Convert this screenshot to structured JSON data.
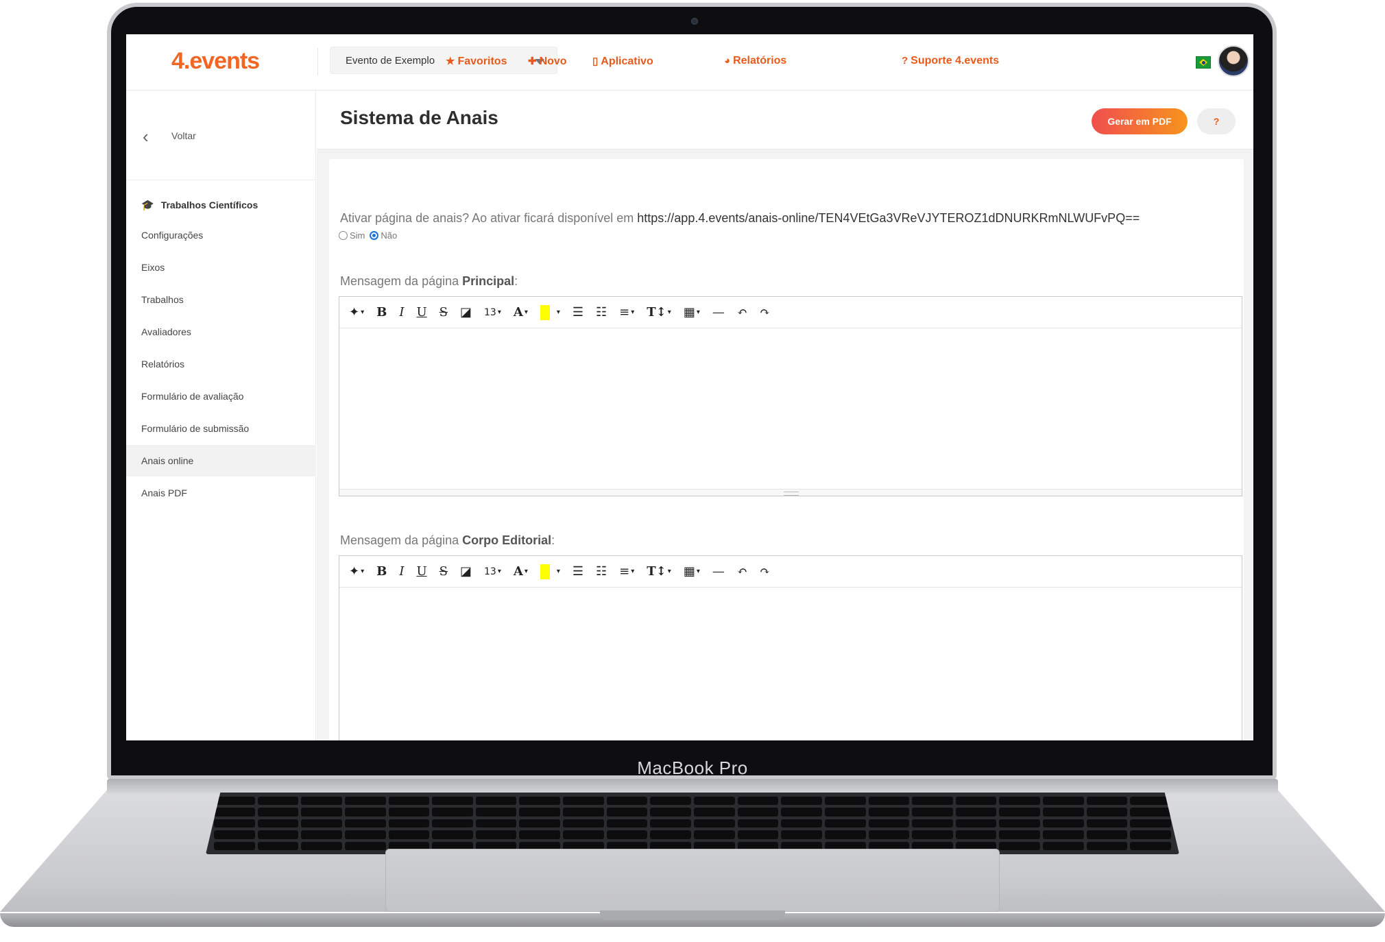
{
  "device": {
    "label": "MacBook Pro"
  },
  "topbar": {
    "logo": "4.events",
    "event_select": "Evento de Exemplo",
    "nav": [
      {
        "icon": "star-icon",
        "glyph": "★",
        "label": "Favoritos"
      },
      {
        "icon": "plus-icon",
        "glyph": "✚",
        "label": "Novo"
      },
      {
        "icon": "mobile-icon",
        "glyph": "▯",
        "label": "Aplicativo"
      },
      {
        "icon": "pie-chart-icon",
        "glyph": "◕",
        "label": "Relatórios"
      },
      {
        "icon": "question-circle-icon",
        "glyph": "?",
        "label": "Suporte 4.events"
      }
    ],
    "language_flag": "brazil-flag-icon"
  },
  "sidebar": {
    "back_label": "Voltar",
    "section_title": "Trabalhos Científicos",
    "section_icon": "graduation-cap-icon",
    "items": [
      {
        "label": "Configurações"
      },
      {
        "label": "Eixos"
      },
      {
        "label": "Trabalhos"
      },
      {
        "label": "Avaliadores"
      },
      {
        "label": "Relatórios"
      },
      {
        "label": "Formulário de avaliação"
      },
      {
        "label": "Formulário de submissão"
      },
      {
        "label": "Anais online",
        "active": true
      },
      {
        "label": "Anais PDF"
      }
    ]
  },
  "page": {
    "title": "Sistema de Anais",
    "pdf_button": "Gerar em PDF",
    "help_button": "?",
    "question": "Ativar página de anais? Ao ativar ficará disponível em",
    "question_url": "https://app.4.events/anais-online/TEN4VEtGa3VReVJYTEROZ1dDNURKRmNLWUFvPQ==",
    "radio_yes": "Sim",
    "radio_no": "Não",
    "radio_selected": "Não",
    "editor1_prefix": "Mensagem da página",
    "editor1_bold": "Principal",
    "editor2_prefix": "Mensagem da página",
    "editor2_bold": "Corpo Editorial",
    "font_size": "13"
  },
  "colors": {
    "accent": "#f26522",
    "nav": "#e85a1a",
    "pdf_gradient_start": "#f04e4e",
    "pdf_gradient_end": "#f7941d",
    "radio": "#1e73d8",
    "highlight": "#ffff00"
  }
}
